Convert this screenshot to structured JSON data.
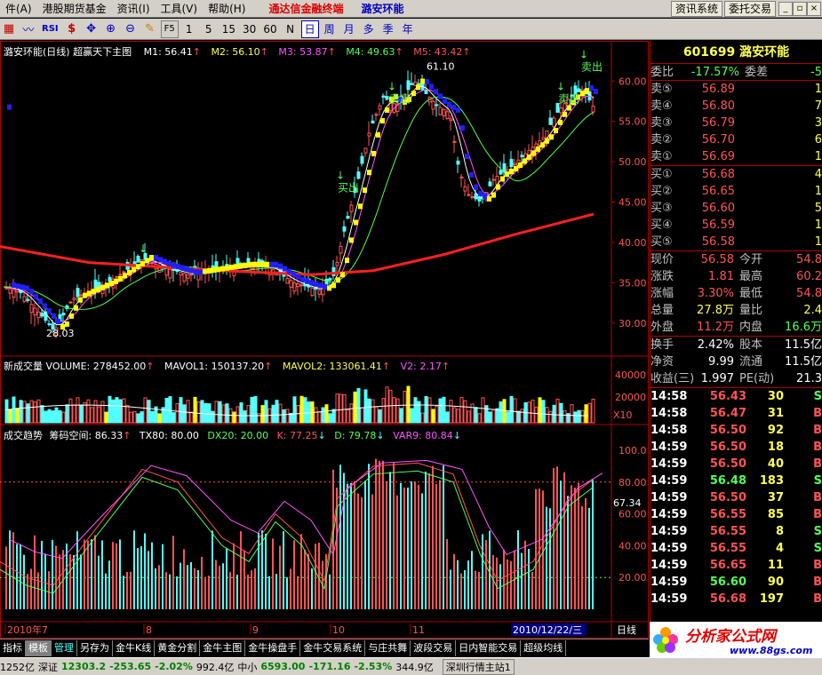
{
  "menu": {
    "items": [
      "件(A)",
      "港股期货基金",
      "资讯(I)",
      "工具(V)",
      "帮助(H)"
    ],
    "brand": "通达信金融终端",
    "stock_name": "潞安环能",
    "right_buttons": [
      "资讯系统",
      "委托交易"
    ]
  },
  "toolbar": {
    "icons": [
      "chart-icon",
      "indicator-icon",
      "rsi-icon",
      "dollar-icon",
      "move-icon",
      "zoom-in-icon",
      "zoom-out-icon",
      "draw-icon",
      "f5-icon"
    ],
    "rsi_label": "RSI",
    "f5_label": "F5",
    "periods": [
      "1",
      "5",
      "15",
      "30",
      "60",
      "N",
      "日",
      "周",
      "月",
      "多",
      "季",
      "年"
    ],
    "active_period": "日"
  },
  "main_chart": {
    "title": "潞安环能(日线) 超赢天下主图",
    "m1": "M1: 56.41",
    "m2": "M2: 56.10",
    "m3": "M3: 53.87",
    "m4": "M4: 49.63",
    "m5": "M5: 43.42",
    "high_label": "61.10",
    "low_label": "28.03",
    "sell_label": "卖出",
    "buy_label": "买出",
    "y_ticks": [
      "60.00",
      "55.00",
      "50.00",
      "45.00",
      "40.00",
      "35.00",
      "30.00"
    ]
  },
  "volume_chart": {
    "title": "新成交量 VOLUME: 278452.00",
    "mavol1": "MAVOL1: 150137.20",
    "mavol2": "MAVOL2: 133061.41",
    "v2": "V2: 2.17",
    "y_ticks": [
      "40000",
      "20000"
    ],
    "unit": "X10"
  },
  "indicator_chart": {
    "title": "成交趋势",
    "chouma": "筹码空间: 86.33",
    "tx80": "TX80: 80.00",
    "dx20": "DX20: 20.00",
    "k": "K: 77.25",
    "d": "D: 79.78",
    "var9": "VAR9: 80.84",
    "y_ticks": [
      "100.0",
      "80.00",
      "60.00",
      "40.00",
      "20.00"
    ],
    "current_value": "67.34"
  },
  "x_axis": {
    "labels": [
      "2010年7",
      "8",
      "9",
      "10",
      "11"
    ],
    "cursor_date": "2010/12/22/三",
    "period": "日线"
  },
  "panel": {
    "code_name": "601699 潞安环能",
    "weibi_label": "委比",
    "weibi_value": "-17.57%",
    "weicha_label": "委差",
    "weicha_value": "-5",
    "asks": [
      {
        "label": "卖⑤",
        "price": "56.89",
        "vol": "1"
      },
      {
        "label": "卖④",
        "price": "56.80",
        "vol": "7"
      },
      {
        "label": "卖③",
        "price": "56.79",
        "vol": "3"
      },
      {
        "label": "卖②",
        "price": "56.70",
        "vol": "6"
      },
      {
        "label": "卖①",
        "price": "56.69",
        "vol": "1"
      }
    ],
    "bids": [
      {
        "label": "买①",
        "price": "56.68",
        "vol": "4"
      },
      {
        "label": "买②",
        "price": "56.65",
        "vol": "1"
      },
      {
        "label": "买③",
        "price": "56.60",
        "vol": "5"
      },
      {
        "label": "买④",
        "price": "56.59",
        "vol": "1"
      },
      {
        "label": "买⑤",
        "price": "56.58",
        "vol": "1"
      }
    ],
    "stats": [
      {
        "l1": "现价",
        "v1": "56.58",
        "l2": "今开",
        "v2": "54.8"
      },
      {
        "l1": "涨跌",
        "v1": "1.81",
        "l2": "最高",
        "v2": "60.2"
      },
      {
        "l1": "涨幅",
        "v1": "3.30%",
        "l2": "最低",
        "v2": "54.8"
      },
      {
        "l1": "总量",
        "v1": "27.8万",
        "l2": "量比",
        "v2": "2.4"
      },
      {
        "l1": "外盘",
        "v1": "11.2万",
        "l2": "内盘",
        "v2": "16.6万"
      }
    ],
    "fin": [
      {
        "l1": "换手",
        "v1": "2.42%",
        "l2": "股本",
        "v2": "11.5亿"
      },
      {
        "l1": "净资",
        "v1": "9.99",
        "l2": "流通",
        "v2": "11.5亿"
      },
      {
        "l1": "收益(三)",
        "v1": "1.997",
        "l2": "PE(动)",
        "v2": "21.3"
      }
    ],
    "ticks": [
      {
        "time": "14:58",
        "price": "56.43",
        "vol": "30",
        "dir": "S"
      },
      {
        "time": "14:58",
        "price": "56.47",
        "vol": "31",
        "dir": "B"
      },
      {
        "time": "14:58",
        "price": "56.50",
        "vol": "92",
        "dir": "B"
      },
      {
        "time": "14:59",
        "price": "56.50",
        "vol": "18",
        "dir": "B"
      },
      {
        "time": "14:59",
        "price": "56.50",
        "vol": "40",
        "dir": "B"
      },
      {
        "time": "14:59",
        "price": "56.48",
        "vol": "183",
        "dir": "S"
      },
      {
        "time": "14:59",
        "price": "56.50",
        "vol": "37",
        "dir": "B"
      },
      {
        "time": "14:59",
        "price": "56.55",
        "vol": "85",
        "dir": "B"
      },
      {
        "time": "14:59",
        "price": "56.55",
        "vol": "8",
        "dir": "S"
      },
      {
        "time": "14:59",
        "price": "56.55",
        "vol": "4",
        "dir": "S"
      },
      {
        "time": "14:59",
        "price": "56.65",
        "vol": "11",
        "dir": "B"
      },
      {
        "time": "14:59",
        "price": "56.60",
        "vol": "90",
        "dir": "B"
      },
      {
        "time": "14:59",
        "price": "56.68",
        "vol": "197",
        "dir": "B"
      }
    ]
  },
  "tabs": [
    "指标",
    "模板",
    "管理",
    "另存为",
    "金牛K线",
    "黄金分割",
    "金牛主图",
    "金牛操盘手",
    "金牛交易系统",
    "与庄共舞",
    "波段交易",
    "日内智能交易",
    "超级均线"
  ],
  "active_tab": "管理",
  "status": {
    "s1": "1252亿",
    "s2_label": "深证",
    "s2_value": "12303.2",
    "s2_change": "-253.65",
    "s2_pct": "-2.02%",
    "s2_amount": "992.4亿",
    "s3_label": "中小",
    "s3_value": "6593.00",
    "s3_change": "-171.16",
    "s3_pct": "-2.53%",
    "s3_amount": "344.9亿",
    "s4": "深圳行情主站1"
  },
  "logo": {
    "text": "分析家公式网",
    "url": "www.88gs.com"
  },
  "colors": {
    "up": "#ff5454",
    "down": "#54ffff",
    "ma_white": "#ffffff",
    "ma_yellow": "#ffff00",
    "ma_magenta": "#ff54ff",
    "ma_green": "#54ff54",
    "ma_red": "#ff2020",
    "panel_border": "#b00000"
  }
}
